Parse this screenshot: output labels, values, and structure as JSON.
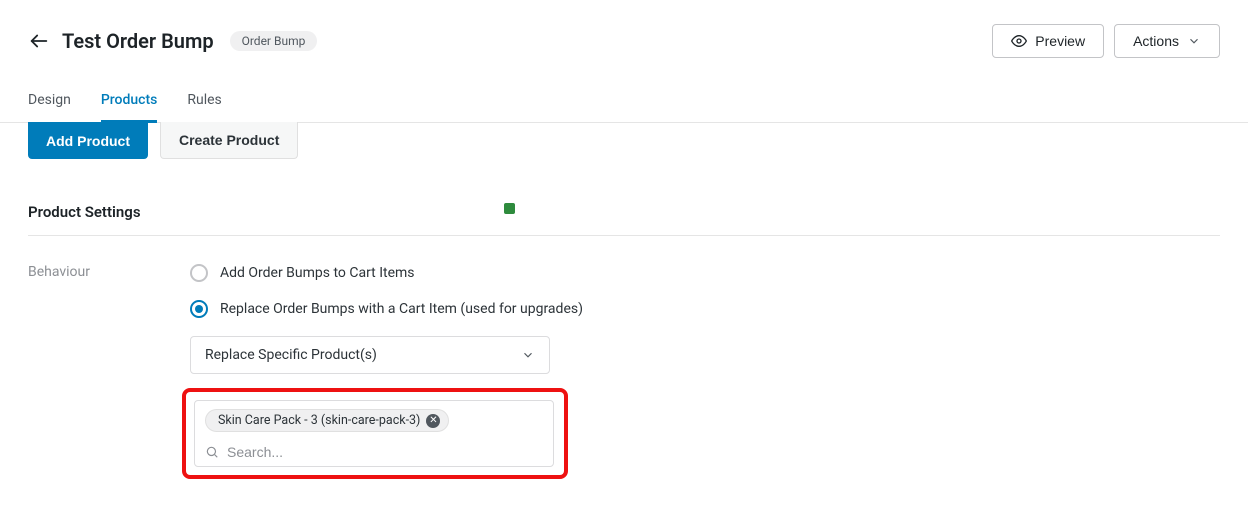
{
  "header": {
    "title": "Test Order Bump",
    "badge": "Order Bump",
    "preview_label": "Preview",
    "actions_label": "Actions"
  },
  "tabs": {
    "design": "Design",
    "products": "Products",
    "rules": "Rules"
  },
  "buttons": {
    "add_product": "Add Product",
    "create_product": "Create Product"
  },
  "section": {
    "title": "Product Settings"
  },
  "behaviour": {
    "label": "Behaviour",
    "option_add": "Add Order Bumps to Cart Items",
    "option_replace": "Replace Order Bumps with a Cart Item (used for upgrades)"
  },
  "replace_select": {
    "label": "Replace Specific Product(s)"
  },
  "tag": {
    "label": "Skin Care Pack - 3 (skin-care-pack-3)"
  },
  "search": {
    "placeholder": "Search..."
  }
}
